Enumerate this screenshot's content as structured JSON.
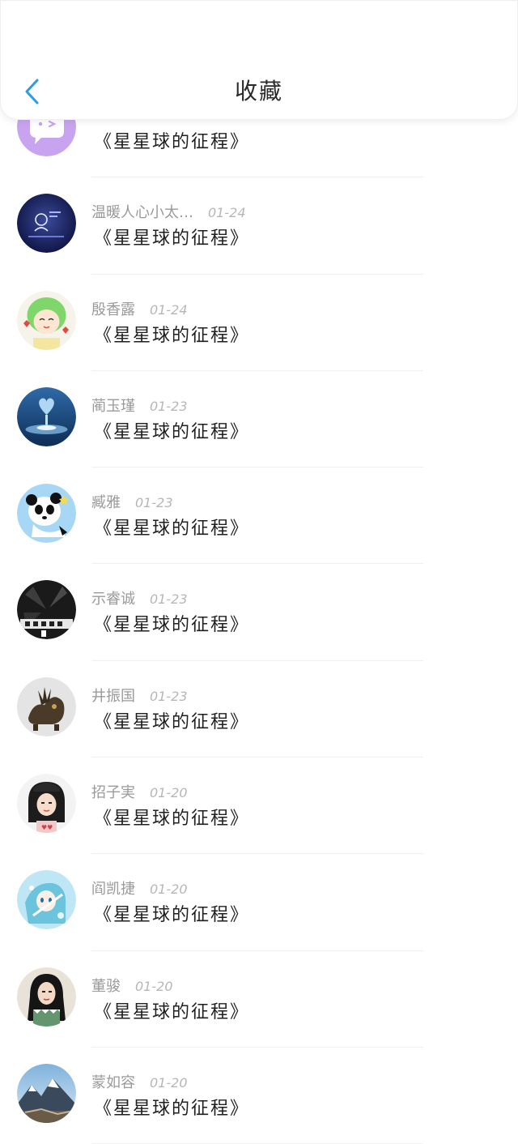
{
  "header": {
    "title": "收藏"
  },
  "colors": {
    "accent": "#2b9de0",
    "name_text": "#9a9a9a",
    "date_text": "#b6b6b6",
    "work_text": "#1f1f1f"
  },
  "items": [
    {
      "name": "",
      "date": "",
      "work": "《星星球的征程》",
      "avatar": "purple-chat-icon"
    },
    {
      "name": "温暖人心小太…",
      "date": "01-24",
      "work": "《星星球的征程》",
      "avatar": "dark-night-avatar"
    },
    {
      "name": "殷香露",
      "date": "01-24",
      "work": "《星星球的征程》",
      "avatar": "green-hair-girl-avatar"
    },
    {
      "name": "蔺玉瑾",
      "date": "01-23",
      "work": "《星星球的征程》",
      "avatar": "water-heart-avatar"
    },
    {
      "name": "臧雅",
      "date": "01-23",
      "work": "《星星球的征程》",
      "avatar": "panda-avatar"
    },
    {
      "name": "示睿诚",
      "date": "01-23",
      "work": "《星星球的征程》",
      "avatar": "dark-wheel-avatar"
    },
    {
      "name": "井振国",
      "date": "01-23",
      "work": "《星星球的征程》",
      "avatar": "dragon-sculpture-avatar"
    },
    {
      "name": "招子実",
      "date": "01-20",
      "work": "《星星球的征程》",
      "avatar": "girl-beanie-avatar"
    },
    {
      "name": "阎凯捷",
      "date": "01-20",
      "work": "《星星球的征程》",
      "avatar": "anime-blue-avatar"
    },
    {
      "name": "董骏",
      "date": "01-20",
      "work": "《星星球的征程》",
      "avatar": "girl-portrait-avatar"
    },
    {
      "name": "蒙如容",
      "date": "01-20",
      "work": "《星星球的征程》",
      "avatar": "mountain-avatar"
    }
  ]
}
